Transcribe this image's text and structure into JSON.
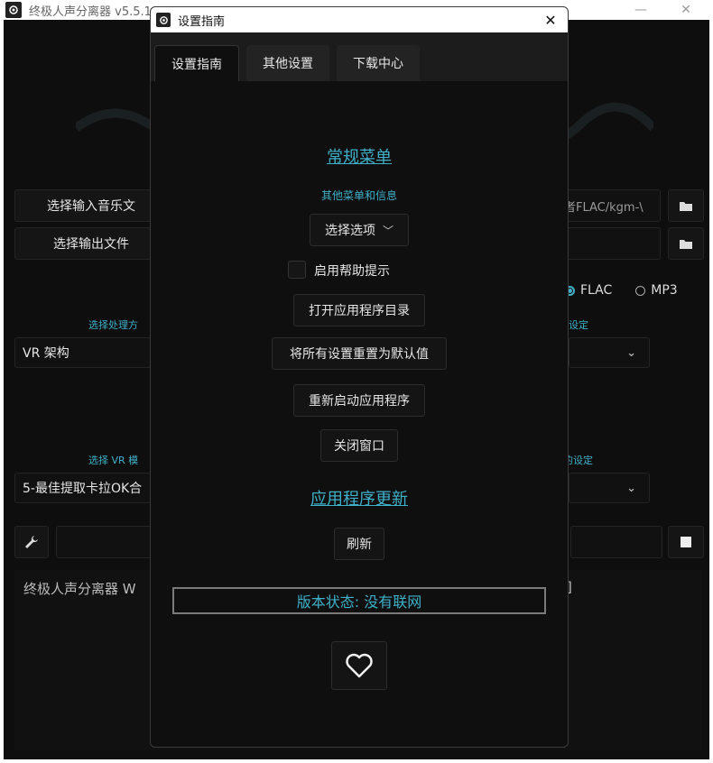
{
  "main_window": {
    "title": "终极人声分离器 v5.5.1",
    "select_input_button": "选择输入音乐文",
    "select_output_button": "选择输出文件",
    "input_path_hint": "者FLAC/kgm-\\",
    "format_flac": "FLAC",
    "format_mp3": "MP3",
    "process_method_label": "选择处理方",
    "process_method_value": "VR 架构",
    "right_settings_label": "设定",
    "vr_model_label": "选择 VR 模",
    "vr_model_value": "5-最佳提取卡拉OK合",
    "right_settings_label_2": "的设定",
    "console_text": "终极人声分离器  W",
    "console_right_bracket": "]"
  },
  "dialog": {
    "title": "设置指南",
    "tabs": [
      {
        "label": "设置指南"
      },
      {
        "label": "其他设置"
      },
      {
        "label": "下载中心"
      }
    ],
    "general_menu_link": "常规菜单",
    "other_menu_label": "其他菜单和信息",
    "select_option_label": "选择选项",
    "enable_help_label": "启用帮助提示",
    "open_app_dir_button": "打开应用程序目录",
    "reset_defaults_button": "将所有设置重置为默认值",
    "restart_app_button": "重新启动应用程序",
    "close_window_button": "关闭窗口",
    "app_update_link": "应用程序更新",
    "refresh_button": "刷新",
    "version_status": "版本状态: 没有联网"
  },
  "colors": {
    "accent": "#3fb0c8",
    "background": "#0f0f0f",
    "button": "#141414"
  },
  "icons": {
    "folder": "folder-icon",
    "wrench": "wrench-icon",
    "stop": "stop-icon",
    "heart": "heart-icon",
    "close": "close-icon",
    "chevron": "chevron-down-icon"
  }
}
